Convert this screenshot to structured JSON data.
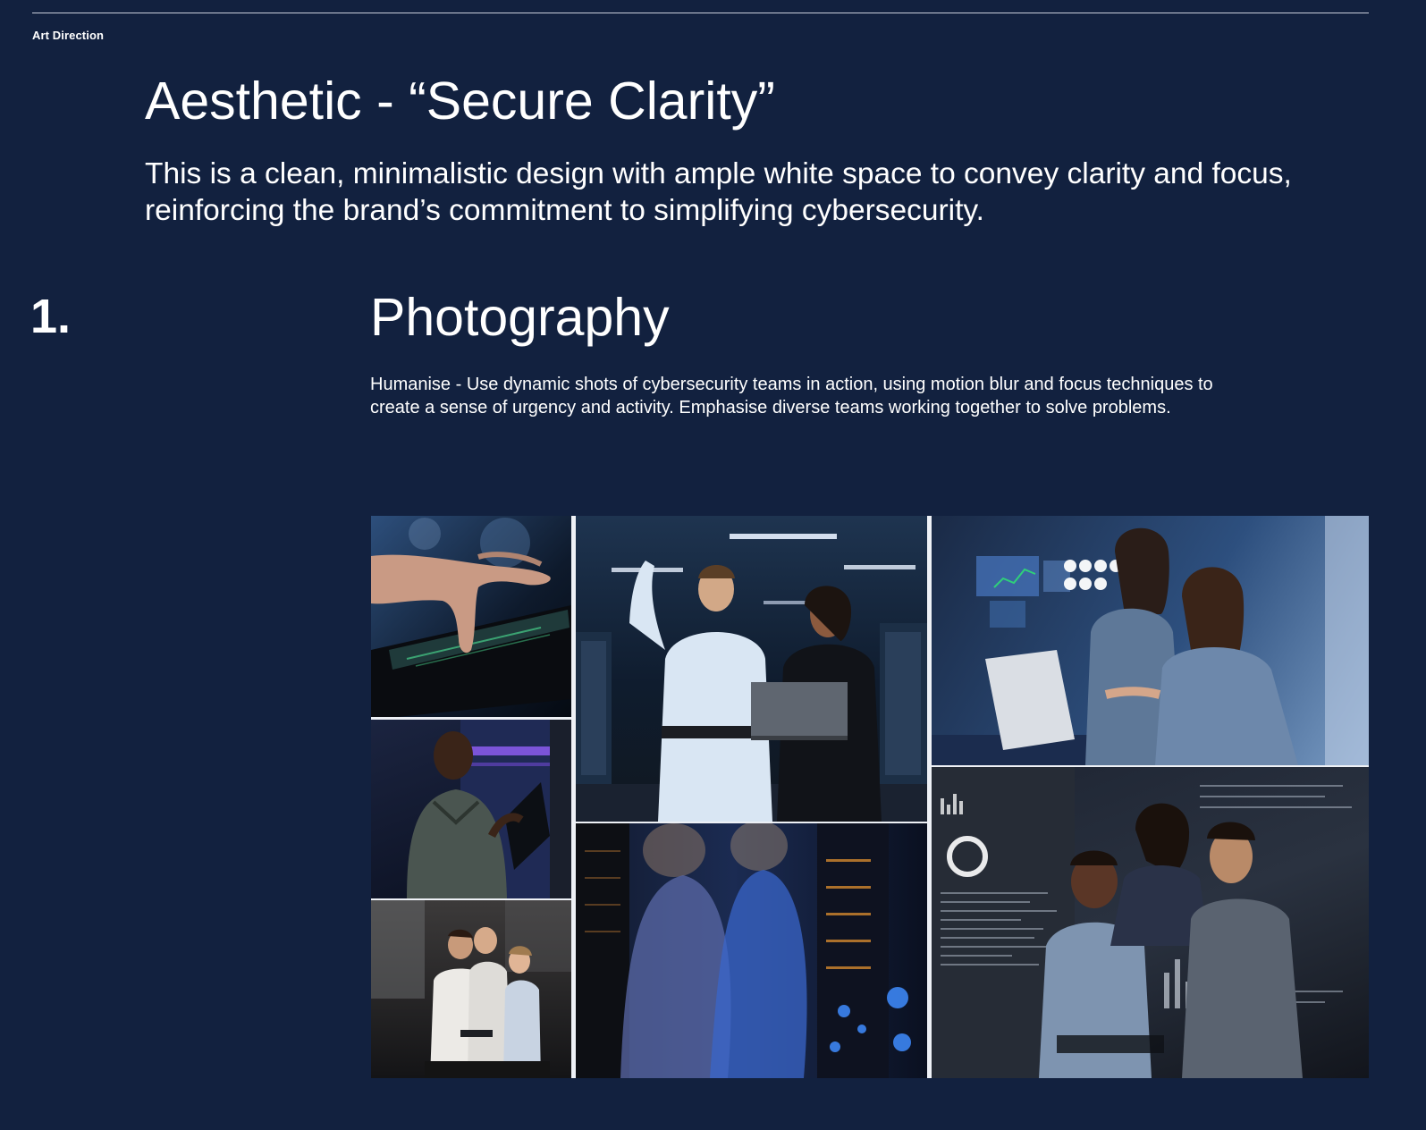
{
  "header": {
    "section_label": "Art Direction"
  },
  "aesthetic": {
    "title": "Aesthetic - “Secure Clarity”",
    "description": "This is a clean, minimalistic design with ample white space to convey clarity and focus, reinforcing the brand’s commitment to simplifying cybersecurity."
  },
  "section": {
    "number": "1.",
    "title": "Photography",
    "description": "Humanise - Use dynamic shots of cybersecurity teams in action, using motion blur and focus techniques to create a sense of urgency and activity. Emphasise diverse teams working together to solve problems."
  },
  "colors": {
    "background": "#12213f",
    "text": "#ffffff",
    "rule": "#c9ceda"
  }
}
